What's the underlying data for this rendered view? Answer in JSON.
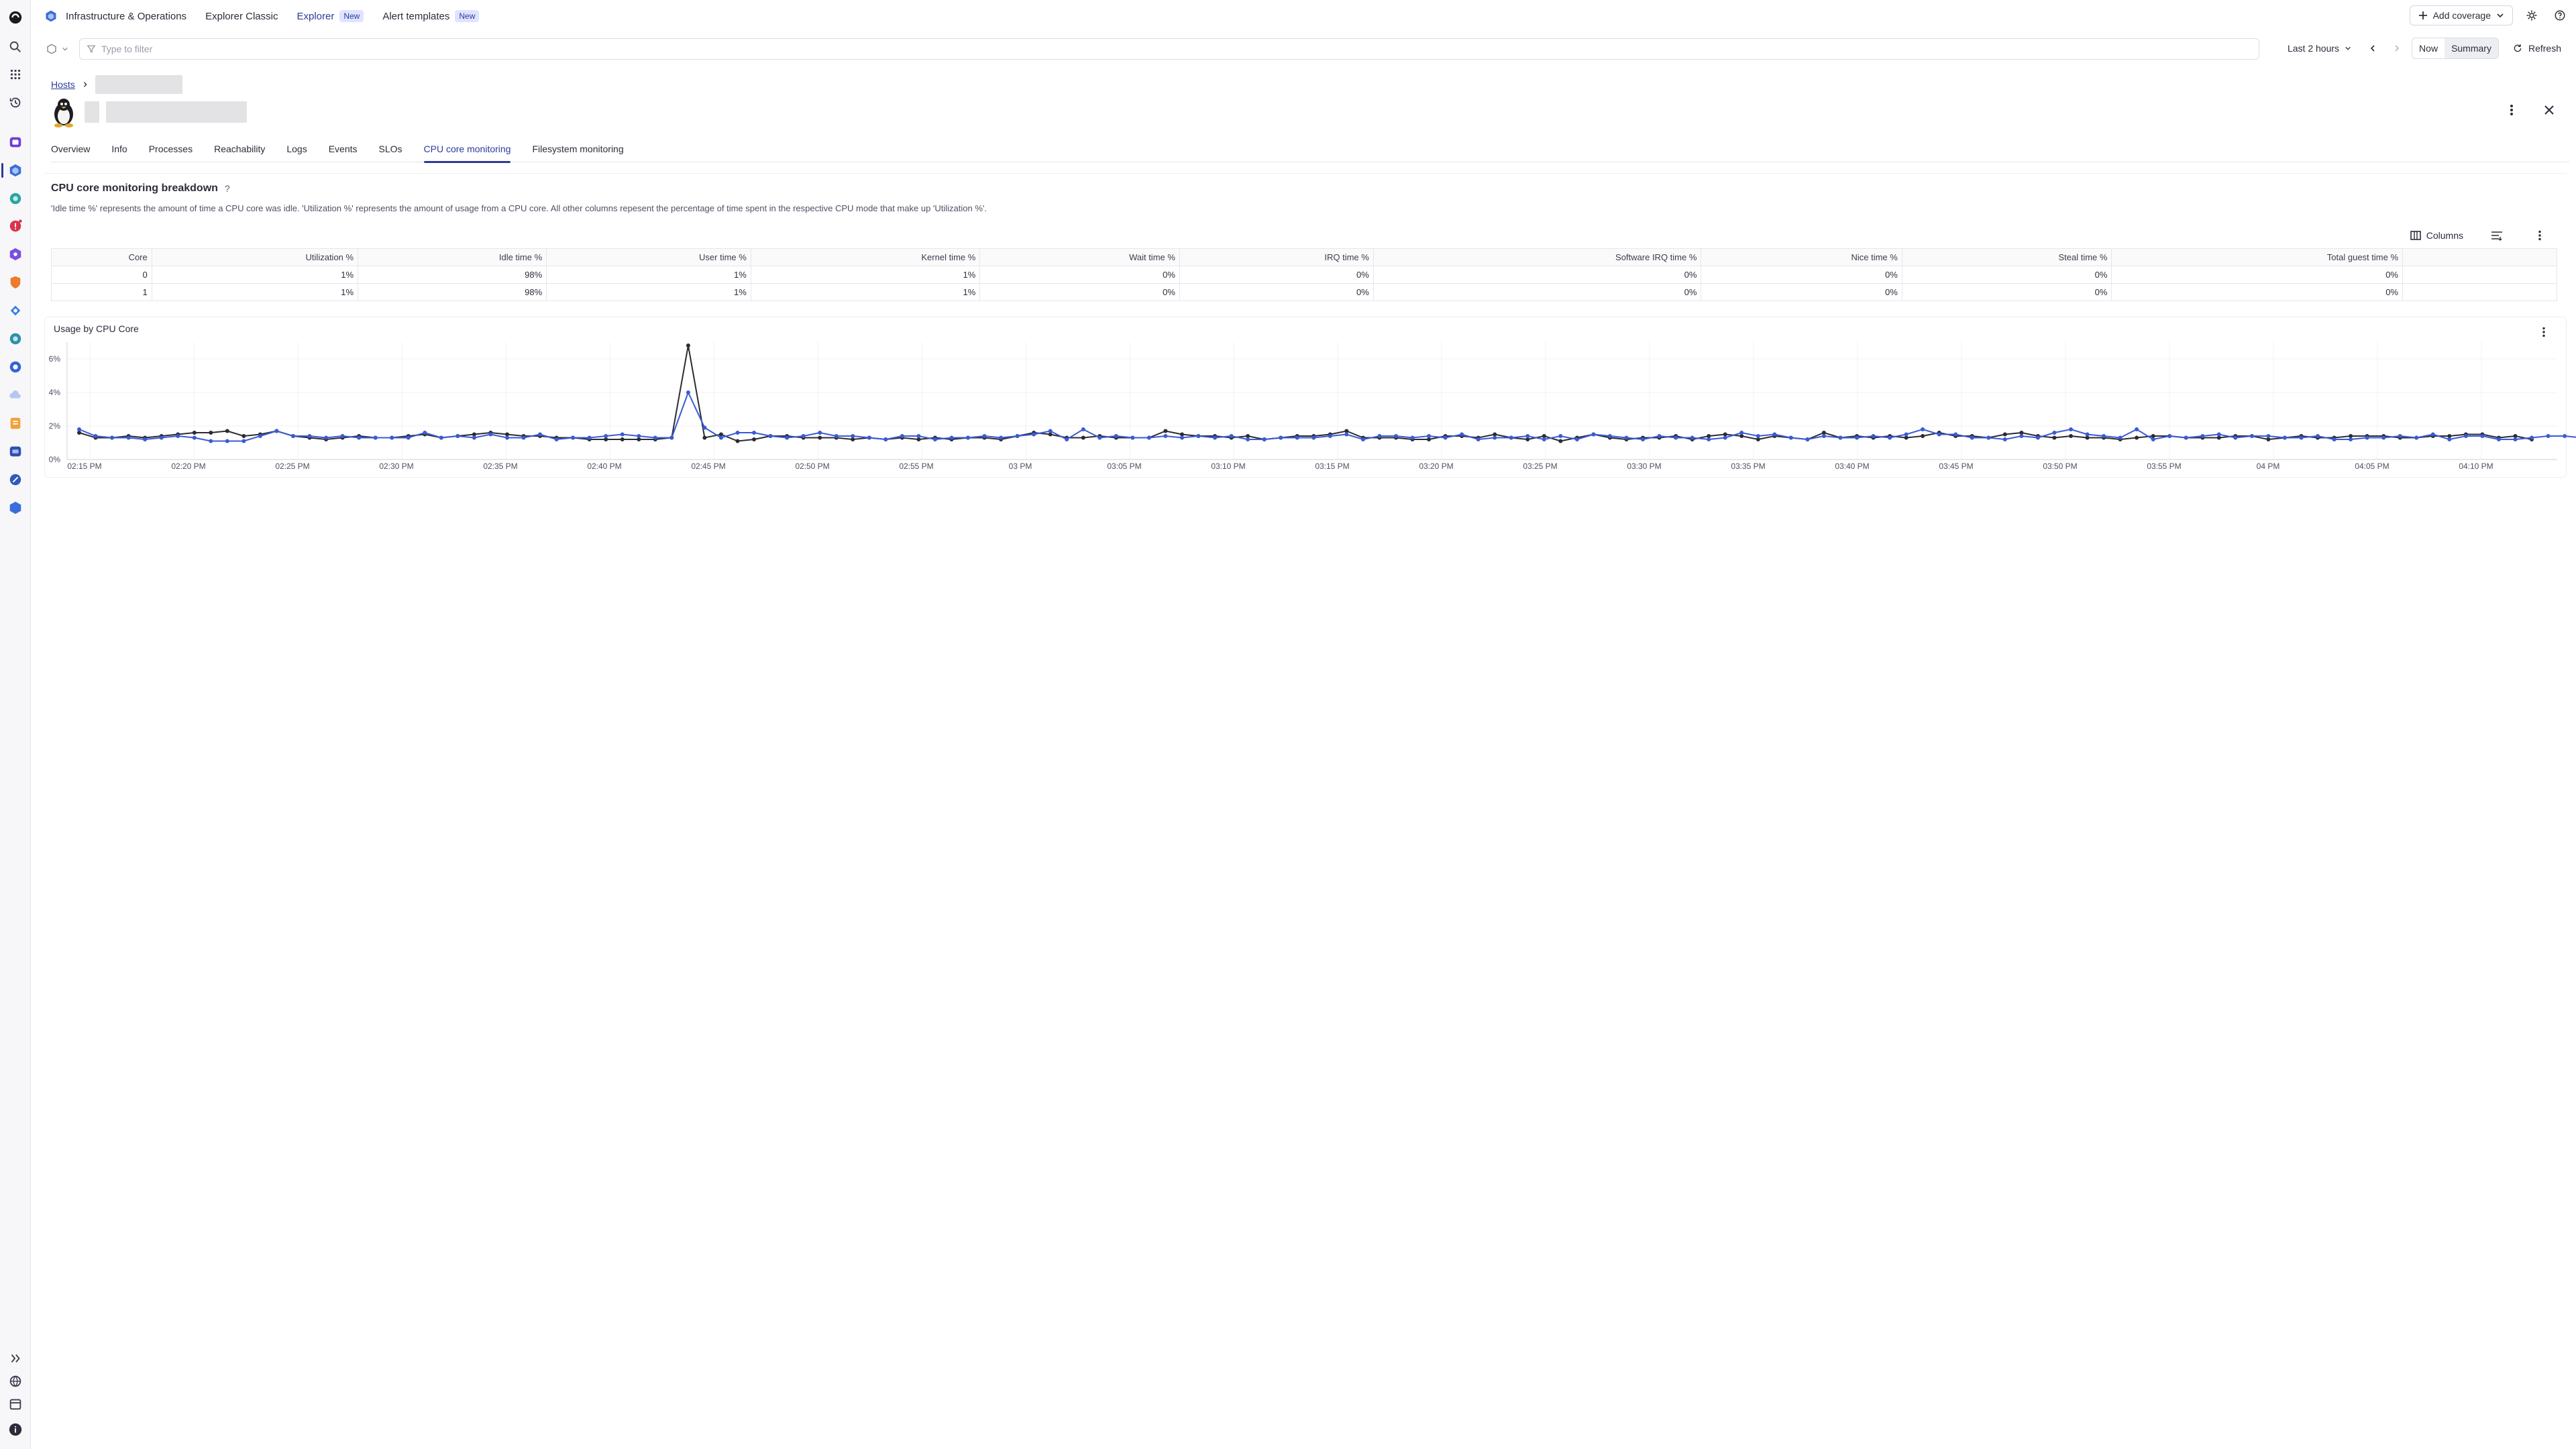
{
  "app": {
    "name": "Infrastructure & Operations"
  },
  "nav": {
    "links": [
      {
        "label": "Explorer Classic",
        "badge": ""
      },
      {
        "label": "Explorer",
        "badge": "New"
      },
      {
        "label": "Alert templates",
        "badge": "New"
      }
    ],
    "add_coverage": "Add coverage"
  },
  "filter": {
    "placeholder": "Type to filter",
    "timeframe": "Last 2 hours",
    "now": "Now",
    "summary": "Summary",
    "refresh": "Refresh"
  },
  "breadcrumb": {
    "root": "Hosts"
  },
  "tabs": [
    "Overview",
    "Info",
    "Processes",
    "Reachability",
    "Logs",
    "Events",
    "SLOs",
    "CPU core monitoring",
    "Filesystem monitoring"
  ],
  "active_tab": "CPU core monitoring",
  "section": {
    "title": "CPU core monitoring breakdown",
    "help": "?",
    "description": "'Idle time %' represents the amount of time a CPU core was idle. 'Utilization %' represents the amount of usage from a CPU core. All other columns repesent the percentage of time spent in the respective CPU mode that make up 'Utilization %'.",
    "columns_button": "Columns"
  },
  "table": {
    "headers": [
      "Core",
      "Utilization %",
      "Idle time %",
      "User time %",
      "Kernel time %",
      "Wait time %",
      "IRQ time %",
      "Software IRQ time %",
      "Nice time %",
      "Steal time %",
      "Total guest time %"
    ],
    "rows": [
      [
        "0",
        "1%",
        "98%",
        "1%",
        "1%",
        "0%",
        "0%",
        "0%",
        "0%",
        "0%",
        "0%"
      ],
      [
        "1",
        "1%",
        "98%",
        "1%",
        "1%",
        "0%",
        "0%",
        "0%",
        "0%",
        "0%",
        "0%"
      ]
    ]
  },
  "chart_data": {
    "type": "line",
    "title": "Usage by CPU Core",
    "xlabel": "",
    "ylabel": "",
    "ylim": [
      0,
      7
    ],
    "y_ticks": [
      "0%",
      "2%",
      "4%",
      "6%"
    ],
    "x_ticks": [
      "02:15 PM",
      "02:20 PM",
      "02:25 PM",
      "02:30 PM",
      "02:35 PM",
      "02:40 PM",
      "02:45 PM",
      "02:50 PM",
      "02:55 PM",
      "03 PM",
      "03:05 PM",
      "03:10 PM",
      "03:15 PM",
      "03:20 PM",
      "03:25 PM",
      "03:30 PM",
      "03:35 PM",
      "03:40 PM",
      "03:45 PM",
      "03:50 PM",
      "03:55 PM",
      "04 PM",
      "04:05 PM",
      "04:10 PM"
    ],
    "x_start_minutes": 14,
    "x_step_minutes": 1,
    "series": [
      {
        "color": "#2b2b33",
        "values": [
          1.6,
          1.3,
          1.3,
          1.4,
          1.3,
          1.4,
          1.5,
          1.6,
          1.6,
          1.7,
          1.4,
          1.5,
          1.7,
          1.4,
          1.3,
          1.2,
          1.3,
          1.4,
          1.3,
          1.3,
          1.4,
          1.5,
          1.3,
          1.4,
          1.5,
          1.6,
          1.5,
          1.4,
          1.4,
          1.3,
          1.3,
          1.2,
          1.2,
          1.2,
          1.2,
          1.2,
          1.3,
          6.8,
          1.3,
          1.5,
          1.1,
          1.2,
          1.4,
          1.4,
          1.3,
          1.3,
          1.3,
          1.2,
          1.3,
          1.2,
          1.3,
          1.2,
          1.3,
          1.2,
          1.3,
          1.3,
          1.2,
          1.4,
          1.6,
          1.5,
          1.3,
          1.3,
          1.4,
          1.3,
          1.3,
          1.3,
          1.7,
          1.5,
          1.4,
          1.4,
          1.3,
          1.4,
          1.2,
          1.3,
          1.4,
          1.4,
          1.5,
          1.7,
          1.3,
          1.3,
          1.3,
          1.2,
          1.2,
          1.4,
          1.4,
          1.3,
          1.5,
          1.3,
          1.2,
          1.4,
          1.1,
          1.3,
          1.5,
          1.3,
          1.2,
          1.3,
          1.3,
          1.4,
          1.2,
          1.4,
          1.5,
          1.4,
          1.2,
          1.4,
          1.3,
          1.2,
          1.6,
          1.3,
          1.4,
          1.3,
          1.4,
          1.3,
          1.4,
          1.6,
          1.4,
          1.4,
          1.3,
          1.5,
          1.6,
          1.4,
          1.3,
          1.4,
          1.3,
          1.3,
          1.2,
          1.3,
          1.4,
          1.4,
          1.3,
          1.3,
          1.3,
          1.4,
          1.4,
          1.2,
          1.3,
          1.4,
          1.3,
          1.3,
          1.4,
          1.4,
          1.4,
          1.3,
          1.3,
          1.4,
          1.4,
          1.5,
          1.5,
          1.3,
          1.4,
          1.2
        ]
      },
      {
        "color": "#3a5bd4",
        "values": [
          1.8,
          1.4,
          1.3,
          1.3,
          1.2,
          1.3,
          1.4,
          1.3,
          1.1,
          1.1,
          1.1,
          1.4,
          1.7,
          1.4,
          1.4,
          1.3,
          1.4,
          1.3,
          1.3,
          1.3,
          1.3,
          1.6,
          1.3,
          1.4,
          1.3,
          1.5,
          1.3,
          1.3,
          1.5,
          1.2,
          1.3,
          1.3,
          1.4,
          1.5,
          1.4,
          1.3,
          1.3,
          4.0,
          1.9,
          1.3,
          1.6,
          1.6,
          1.4,
          1.3,
          1.4,
          1.6,
          1.4,
          1.4,
          1.3,
          1.2,
          1.4,
          1.4,
          1.2,
          1.3,
          1.3,
          1.4,
          1.3,
          1.4,
          1.5,
          1.7,
          1.2,
          1.8,
          1.3,
          1.4,
          1.3,
          1.3,
          1.4,
          1.3,
          1.4,
          1.3,
          1.4,
          1.2,
          1.2,
          1.3,
          1.3,
          1.3,
          1.4,
          1.5,
          1.2,
          1.4,
          1.4,
          1.3,
          1.4,
          1.3,
          1.5,
          1.2,
          1.3,
          1.3,
          1.4,
          1.2,
          1.4,
          1.2,
          1.5,
          1.4,
          1.3,
          1.2,
          1.4,
          1.3,
          1.3,
          1.2,
          1.3,
          1.6,
          1.4,
          1.5,
          1.3,
          1.2,
          1.4,
          1.3,
          1.3,
          1.4,
          1.3,
          1.5,
          1.8,
          1.5,
          1.5,
          1.3,
          1.3,
          1.2,
          1.4,
          1.3,
          1.6,
          1.8,
          1.5,
          1.4,
          1.3,
          1.8,
          1.2,
          1.4,
          1.3,
          1.4,
          1.5,
          1.3,
          1.4,
          1.4,
          1.3,
          1.3,
          1.4,
          1.2,
          1.2,
          1.3,
          1.3,
          1.4,
          1.3,
          1.5,
          1.2,
          1.4,
          1.4,
          1.2,
          1.2,
          1.3,
          1.4,
          1.4,
          1.3,
          1.2
        ]
      }
    ],
    "grid": true
  }
}
